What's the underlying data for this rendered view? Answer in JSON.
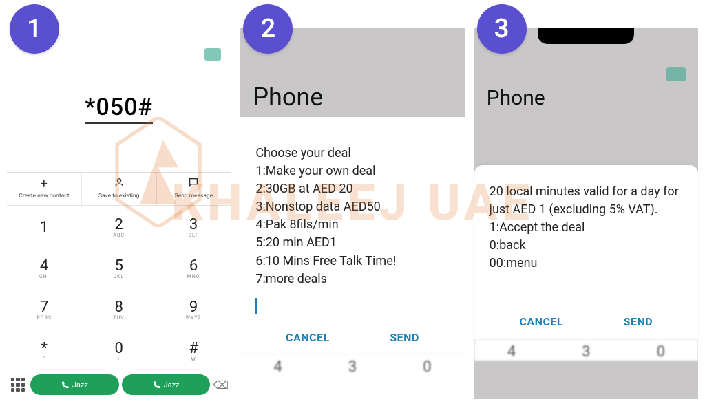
{
  "watermark": "KHALEEJ UAE",
  "steps": {
    "s1": "1",
    "s2": "2",
    "s3": "3"
  },
  "panel1": {
    "dialed": "*050#",
    "actions": {
      "create": "Create new contact",
      "save": "Save to existing",
      "message": "Send message"
    },
    "keys": [
      {
        "d": "1",
        "l": ""
      },
      {
        "d": "2",
        "l": "ABC"
      },
      {
        "d": "3",
        "l": "DEF"
      },
      {
        "d": "4",
        "l": "GHI"
      },
      {
        "d": "5",
        "l": "JKL"
      },
      {
        "d": "6",
        "l": "MNO"
      },
      {
        "d": "7",
        "l": "PQRS"
      },
      {
        "d": "8",
        "l": "TUV"
      },
      {
        "d": "9",
        "l": "WXYZ"
      },
      {
        "d": "*",
        "l": "P"
      },
      {
        "d": "0",
        "l": "+"
      },
      {
        "d": "#",
        "l": "W"
      }
    ],
    "call": "Jazz"
  },
  "panel2": {
    "title": "Phone",
    "lines": [
      "Choose your deal",
      "1:Make your own deal",
      "2:30GB at AED 20",
      "3:Nonstop data AED50",
      "4:Pak 8fils/min",
      "5:20 min AED1",
      "6:10 Mins Free Talk Time!",
      "7:more deals"
    ],
    "cancel": "CANCEL",
    "send": "SEND",
    "blur": [
      "4",
      "3",
      "0"
    ]
  },
  "panel3": {
    "title": "Phone",
    "lines": [
      "20 local minutes valid for a day for just AED 1 (excluding 5% VAT).",
      "1:Accept the deal",
      "0:back",
      "00:menu"
    ],
    "cancel": "CANCEL",
    "send": "SEND",
    "blur": [
      "4",
      "3",
      "0"
    ]
  }
}
